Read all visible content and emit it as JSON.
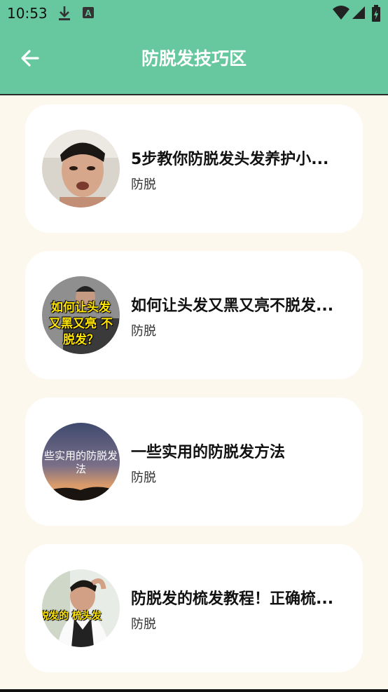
{
  "status_bar": {
    "time": "10:53",
    "icons": [
      "download-icon",
      "a-badge-icon",
      "wifi-icon",
      "signal-icon",
      "battery-icon"
    ]
  },
  "app_bar": {
    "title": "防脱发技巧区",
    "back_icon": "back-arrow-icon"
  },
  "colors": {
    "header": "#67c89f",
    "background": "#fdf8ed",
    "card": "#ffffff"
  },
  "items": [
    {
      "title": "5步教你防脱发头发养护小...",
      "tag": "防脱",
      "thumb_text": ""
    },
    {
      "title": "如何让头发又黑又亮不脱发...",
      "tag": "防脱",
      "thumb_text": "如何让头发 又黑又亮 不脱发？"
    },
    {
      "title": "一些实用的防脱发方法",
      "tag": "防脱",
      "thumb_text": "些实用的防脱发 法"
    },
    {
      "title": "防脱发的梳发教程！正确梳...",
      "tag": "防脱",
      "thumb_text": "脱发的 梳头发"
    }
  ]
}
